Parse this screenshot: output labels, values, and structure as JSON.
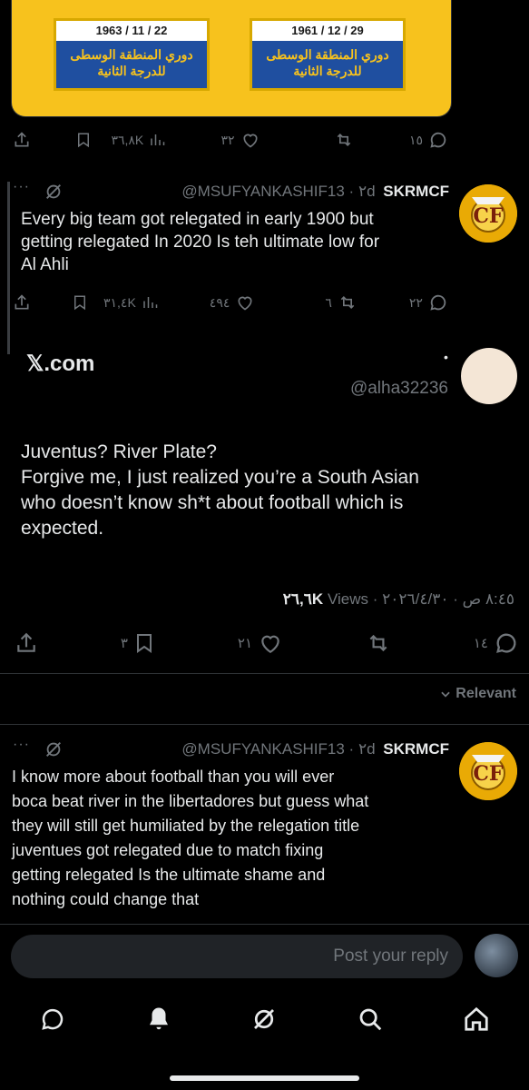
{
  "quote_image": {
    "left_date": "1963 / 11 / 22",
    "right_date": "1961 / 12 / 29",
    "line1": "دوري المنطقة الوسطى",
    "line2": "للدرجة الثانية"
  },
  "tweet1_actions": {
    "views": "٣٦,٨K",
    "likes": "٣٢",
    "retweets": "",
    "replies": "١٥"
  },
  "tweet2": {
    "name": "SKRMCF",
    "handle_time": "@MSUFYANKASHIF13 · ٢d",
    "text_lines": [
      "Every big team got relegated in early 1900 but",
      "getting relegated In 2020 Is teh ultimate low for",
      "Al Ahli"
    ],
    "views": "٣١,٤K",
    "likes": "٤٩٤",
    "retweets": "٦",
    "replies": "٢٢"
  },
  "main_post": {
    "watermark": "𝕏.com",
    "handle": "@alha32236",
    "text_lines": [
      "Juventus? River Plate?",
      "Forgive me, I just realized you’re a South Asian",
      "who doesn’t know sh*t about football which is",
      "expected."
    ],
    "meta_views_count": "٢٦,٦K",
    "meta_views_label": "Views",
    "meta_datetime": "· ٨:٤٥ ص · ٢٠٢٦/٤/٣٠",
    "bookmarks": "٣",
    "likes": "٢١",
    "replies": "١٤"
  },
  "sort_label": "Relevant",
  "reply": {
    "name": "SKRMCF",
    "handle_time": "@MSUFYANKASHIF13 · ٢d",
    "text_lines": [
      "I know more about football than you will ever",
      "boca beat river in the libertadores  but guess what",
      "they will still get humiliated by the relegation title",
      "juventues got relegated due to match fixing",
      "getting relegated Is the ultimate shame and",
      "nothing could change that"
    ]
  },
  "compose": {
    "placeholder": "Post your reply"
  },
  "icons": [
    "share-icon",
    "bookmark-icon",
    "views-icon",
    "heart-icon",
    "retweet-icon",
    "reply-icon",
    "grok-icon",
    "chevron-down-icon",
    "messages-icon",
    "bell-icon",
    "search-icon",
    "home-icon"
  ],
  "colors": {
    "background": "#000000",
    "text": "#e7e9ea",
    "muted": "#71767b",
    "divider": "#2f3336",
    "card_yellow": "#f7c21d",
    "card_blue": "#1f4fa0"
  }
}
